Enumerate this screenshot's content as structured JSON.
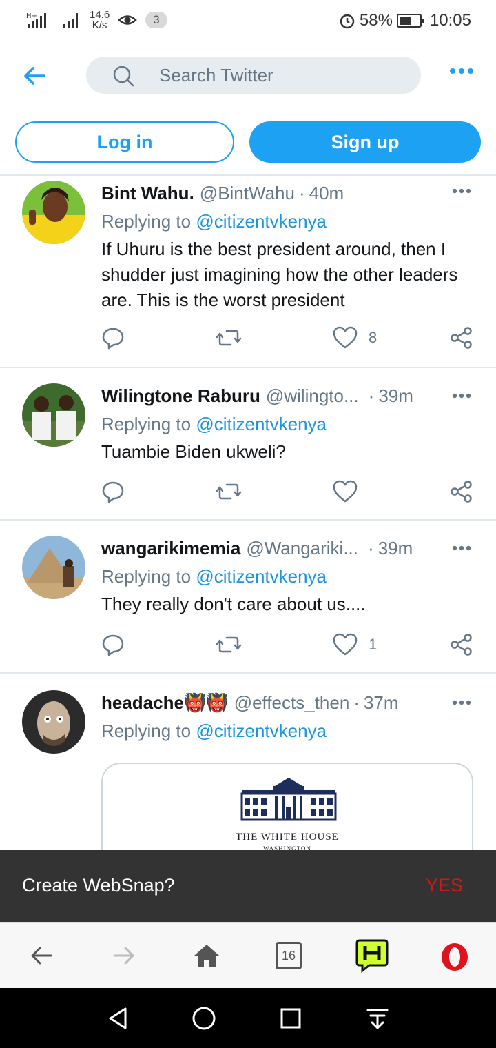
{
  "status_bar": {
    "net_type": "H+",
    "speed_value": "14.6",
    "speed_unit": "K/s",
    "notification_count": "3",
    "battery_level": 0.58,
    "battery": "58%",
    "time": "10:05"
  },
  "header": {
    "search_placeholder": "Search Twitter"
  },
  "auth": {
    "login_label": "Log in",
    "signup_label": "Sign up"
  },
  "tweets": [
    {
      "name": "Bint Wahu.",
      "handle": "@BintWahu",
      "time": "40m",
      "replying_prefix": "Replying to",
      "replying_to": "@citizentvkenya",
      "text": "If Uhuru is the best president around, then I shudder just imagining how the other leaders are. This is the worst president",
      "likes": "8"
    },
    {
      "name": "Wilingtone Raburu",
      "handle": "@wilingto...",
      "time": "39m",
      "replying_prefix": "Replying to",
      "replying_to": "@citizentvkenya",
      "text": "Tuambie Biden ukweli?",
      "likes": ""
    },
    {
      "name": "wangarikimemia",
      "handle": "@Wangariki...",
      "time": "39m",
      "replying_prefix": "Replying to",
      "replying_to": "@citizentvkenya",
      "text": "They really don't care about us....",
      "likes": "1"
    },
    {
      "name": "headache👹👹",
      "handle": "@effects_then",
      "time": "37m",
      "replying_prefix": "Replying to",
      "replying_to": "@citizentvkenya",
      "text": "",
      "likes": ""
    }
  ],
  "card": {
    "title": "THE WHITE HOUSE",
    "subtitle": "WASHINGTON"
  },
  "websnap": {
    "prompt": "Create WebSnap?",
    "yes_label": "YES"
  },
  "browser_bar": {
    "tab_count": "16"
  },
  "colors": {
    "twitter_blue": "#1da1f2",
    "link_blue": "#1b95e0",
    "muted_gray": "#657786",
    "snapbar_bg": "#333333",
    "yes_red": "#cc1a1a",
    "opera_red": "#e0121b"
  }
}
